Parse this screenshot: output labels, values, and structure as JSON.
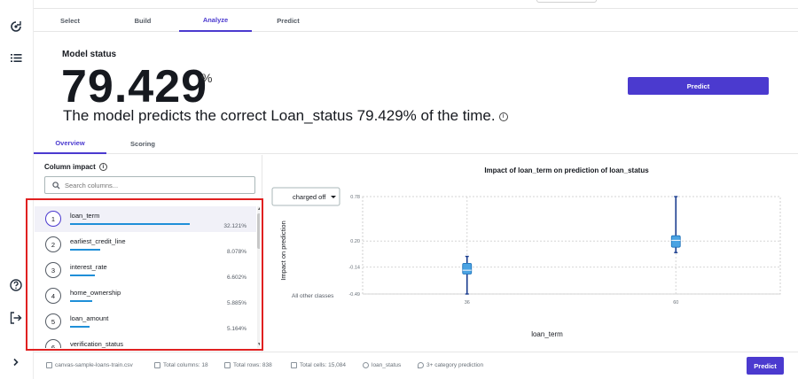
{
  "steps": {
    "tabs": [
      {
        "label": "Select"
      },
      {
        "label": "Build"
      },
      {
        "label": "Analyze"
      },
      {
        "label": "Predict"
      }
    ],
    "active": "Analyze"
  },
  "model_status": {
    "title": "Model status",
    "accuracy": "79.429",
    "percent_sign": "%",
    "description": "The model predicts the correct Loan_status 79.429% of the time.",
    "info_glyph": "i"
  },
  "predict_button": {
    "label": "Predict"
  },
  "subtabs": {
    "tabs": [
      {
        "label": "Overview"
      },
      {
        "label": "Scoring"
      }
    ],
    "active": "Overview"
  },
  "column_impact": {
    "title": "Column impact",
    "info_glyph": "i",
    "search_placeholder": "Search columns...",
    "items": [
      {
        "rank": "1",
        "name": "loan_term",
        "pct": "32.121%",
        "bar_fraction": 0.321,
        "selected": true
      },
      {
        "rank": "2",
        "name": "earliest_credit_line",
        "pct": "8.078%",
        "bar_fraction": 0.081
      },
      {
        "rank": "3",
        "name": "interest_rate",
        "pct": "6.602%",
        "bar_fraction": 0.066
      },
      {
        "rank": "4",
        "name": "home_ownership",
        "pct": "5.885%",
        "bar_fraction": 0.059
      },
      {
        "rank": "5",
        "name": "loan_amount",
        "pct": "5.164%",
        "bar_fraction": 0.052
      },
      {
        "rank": "6",
        "name": "verification_status",
        "pct": "",
        "bar_fraction": 0.04
      }
    ]
  },
  "impact_chart": {
    "title": "Impact of loan_term on prediction of loan_status",
    "class_dropdown": "charged off",
    "ylabel": "Impact on prediction",
    "xlabel": "loan_term",
    "other_classes_label": "All other classes"
  },
  "chart_data": {
    "type": "boxplot",
    "title": "Impact of loan_term on prediction of loan_status",
    "xlabel": "loan_term",
    "ylabel": "Impact on prediction",
    "categories": [
      "36",
      "60"
    ],
    "y_ticks": [
      "0.78",
      "0.20",
      "-0.14",
      "-0.49"
    ],
    "ylim": [
      -0.49,
      0.78
    ],
    "grid": true,
    "series": [
      {
        "category": "36",
        "min": -0.49,
        "q1": -0.23,
        "median": -0.18,
        "q3": -0.09,
        "max": 0.0
      },
      {
        "category": "60",
        "min": 0.05,
        "q1": 0.12,
        "median": 0.21,
        "q3": 0.27,
        "max": 0.78
      }
    ],
    "color": "#4aa3e3"
  },
  "footer": {
    "dataset": "canvas-sample-loans-train.csv",
    "total_columns": "Total columns: 18",
    "total_rows": "Total rows: 838",
    "total_cells": "Total cells: 15,084",
    "target": "loan_status",
    "prediction_type": "3+ category prediction",
    "predict_label": "Predict"
  },
  "colors": {
    "accent": "#4b3acf",
    "bar": "#1f8fd8",
    "highlight": "#e02020"
  },
  "icons": [
    "model-cycle-icon",
    "list-icon",
    "help-icon",
    "sign-out-icon",
    "expand-chevron-icon"
  ]
}
